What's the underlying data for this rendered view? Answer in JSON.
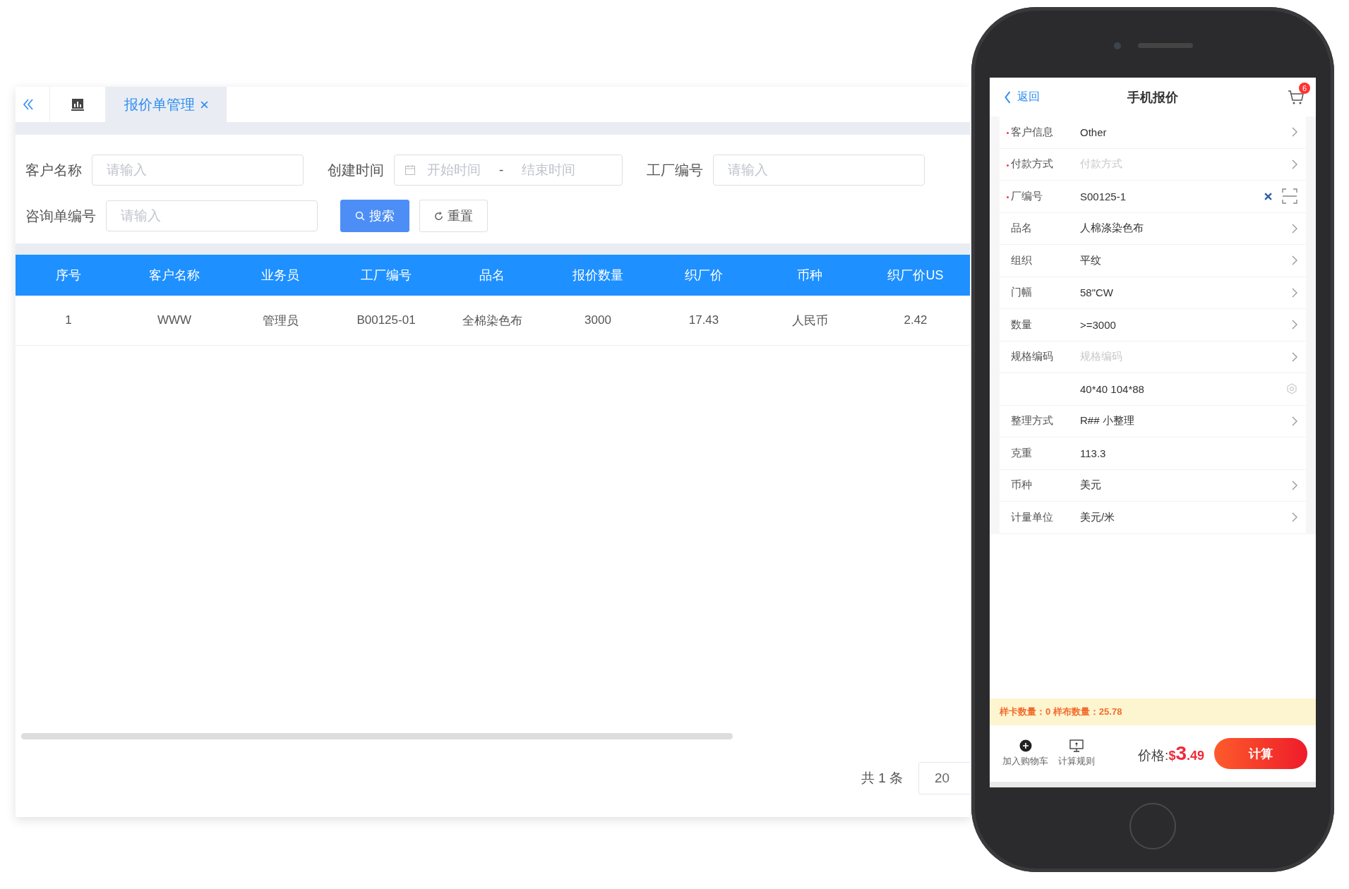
{
  "tabs": [
    {
      "kind": "icon",
      "selected": false
    },
    {
      "kind": "text",
      "label": "报价单管理",
      "selected": true,
      "closable": true
    }
  ],
  "filter_rows": [
    [
      {
        "kind": "text",
        "label": "客户名称",
        "placeholder": "请输入"
      },
      {
        "kind": "daterange",
        "label": "创建时间",
        "start_placeholder": "开始时间",
        "separator": "-",
        "end_placeholder": "结束时间"
      },
      {
        "kind": "text",
        "label": "工厂编号",
        "placeholder": "请输入"
      }
    ],
    [
      {
        "kind": "text",
        "label": "咨询单编号",
        "placeholder": "请输入"
      }
    ]
  ],
  "buttons": [
    {
      "kind": "primary",
      "label": "搜索"
    },
    {
      "kind": "default",
      "label": "重置"
    }
  ],
  "table": {
    "columns": [
      "序号",
      "客户名称",
      "业务员",
      "工厂编号",
      "品名",
      "报价数量",
      "织厂价",
      "币种",
      "织厂价US"
    ],
    "rows": [
      [
        "1",
        "WWW",
        "管理员",
        "B00125-01",
        "全棉染色布",
        "3000",
        "17.43",
        "人民币",
        "2.42"
      ]
    ]
  },
  "pagination": {
    "total": "共 1 条",
    "page_size": "20"
  },
  "phone": {
    "nav": {
      "back": "返回",
      "title": "手机报价",
      "cart_badge": "6"
    },
    "rows": [
      {
        "kind": "select",
        "label": "客户信息",
        "value": "Other",
        "required": true
      },
      {
        "kind": "select",
        "label": "付款方式",
        "placeholder": "付款方式",
        "required": true
      },
      {
        "kind": "input",
        "label": "厂编号",
        "value": "S00125-1",
        "required": true
      },
      {
        "kind": "select",
        "label": "品名",
        "value": "人棉涤染色布",
        "required": false
      },
      {
        "kind": "select",
        "label": "组织",
        "value": "平纹",
        "required": false
      },
      {
        "kind": "select",
        "label": "门幅",
        "value": "58\"CW",
        "required": false
      },
      {
        "kind": "select",
        "label": "数量",
        "value": ">=3000",
        "required": false
      },
      {
        "kind": "select",
        "label": "规格编码",
        "placeholder": "规格编码",
        "required": false
      },
      {
        "kind": "spec",
        "value": "40*40 104*88"
      },
      {
        "kind": "select",
        "label": "整理方式",
        "value": "R## 小整理",
        "required": false
      },
      {
        "kind": "text",
        "label": "克重",
        "value": "113.3",
        "required": false
      },
      {
        "kind": "select",
        "label": "币种",
        "value": "美元",
        "required": false
      },
      {
        "kind": "select",
        "label": "计量单位",
        "value": "美元/米",
        "required": false
      }
    ],
    "notice": "样卡数量：0 样布数量：25.78",
    "actions": [
      {
        "kind": "add",
        "label": "加入购物车"
      },
      {
        "kind": "rules",
        "label": "计算规则"
      }
    ],
    "price": {
      "label": "价格:",
      "currency": "$",
      "integer": "3",
      "decimal": ".49"
    },
    "submit": "计算"
  }
}
